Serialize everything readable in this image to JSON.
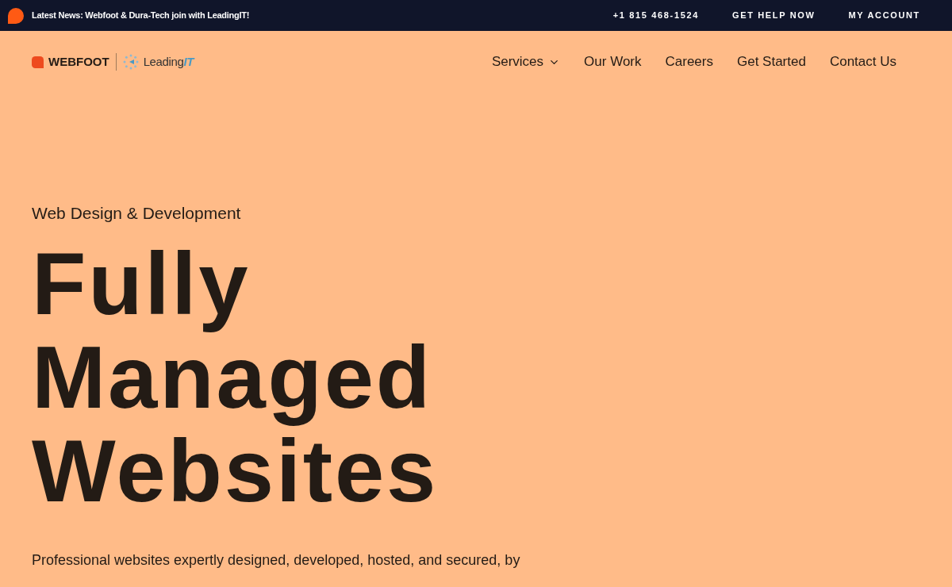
{
  "top_bar": {
    "news": "Latest News: Webfoot & Dura-Tech join with LeadingIT!",
    "links": [
      "+1 815 468-1524",
      "GET HELP NOW",
      "MY ACCOUNT"
    ]
  },
  "logo": {
    "brand": "WEBFOOT",
    "partner": "Leading",
    "partner_suffix": "IT"
  },
  "nav": [
    {
      "label": "Services",
      "dropdown": true
    },
    {
      "label": "Our Work",
      "dropdown": false
    },
    {
      "label": "Careers",
      "dropdown": false
    },
    {
      "label": "Get Started",
      "dropdown": false
    },
    {
      "label": "Contact Us",
      "dropdown": false
    }
  ],
  "hero": {
    "eyebrow": "Web Design & Development",
    "headline": [
      "Fully",
      "Managed",
      "Websites"
    ],
    "body": "Professional websites expertly designed, developed, hosted, and secured, by"
  }
}
